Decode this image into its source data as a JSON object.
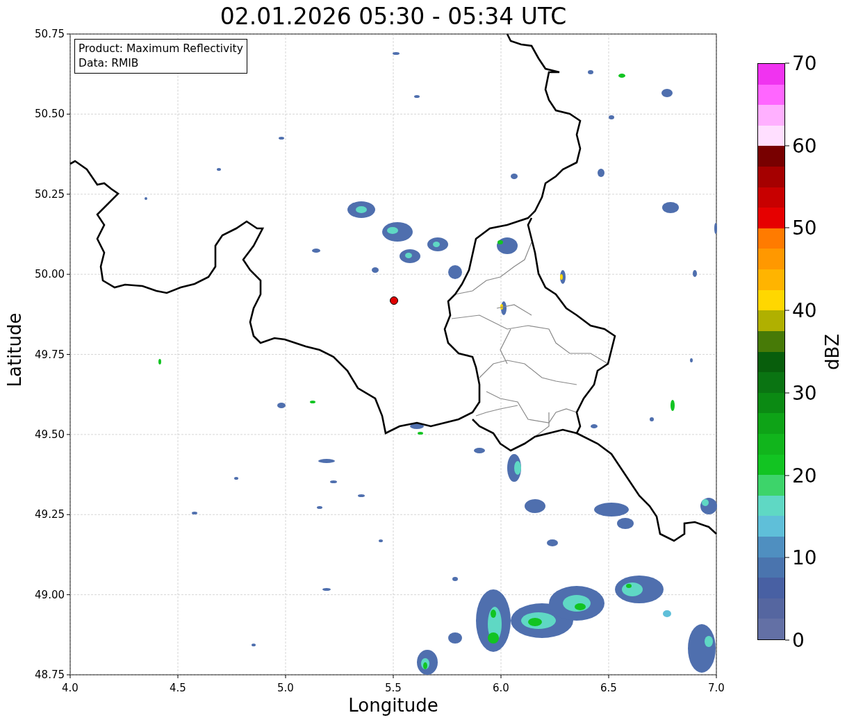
{
  "title": "02.01.2026 05:30 - 05:34 UTC",
  "info_box": [
    "Product: Maximum Reflectivity",
    "Data: RMIB"
  ],
  "x_axis": {
    "label": "Longitude",
    "ticks": [
      "4.0",
      "4.5",
      "5.0",
      "5.5",
      "6.0",
      "6.5",
      "7.0"
    ]
  },
  "y_axis": {
    "label": "Latitude",
    "ticks": [
      "50.75",
      "50.50",
      "50.25",
      "50.00",
      "49.75",
      "49.50",
      "49.25",
      "49.00",
      "48.75"
    ]
  },
  "colorbar": {
    "label": "dBZ",
    "ticks": [
      "70",
      "60",
      "50",
      "40",
      "30",
      "20",
      "10",
      "0"
    ],
    "segments": [
      {
        "color": "#f033f0"
      },
      {
        "color": "#ff66ff"
      },
      {
        "color": "#ffb0ff"
      },
      {
        "color": "#ffdfff"
      },
      {
        "color": "#780000"
      },
      {
        "color": "#a50000"
      },
      {
        "color": "#c80000"
      },
      {
        "color": "#e60000"
      },
      {
        "color": "#ff7b00"
      },
      {
        "color": "#ff9800"
      },
      {
        "color": "#ffb400"
      },
      {
        "color": "#ffd700"
      },
      {
        "color": "#b0b000"
      },
      {
        "color": "#477a07"
      },
      {
        "color": "#085e0c"
      },
      {
        "color": "#0a7412"
      },
      {
        "color": "#0b8a13"
      },
      {
        "color": "#0ea317"
      },
      {
        "color": "#11b51c"
      },
      {
        "color": "#12c422"
      },
      {
        "color": "#3dd46a"
      },
      {
        "color": "#5fd8c4"
      },
      {
        "color": "#5fbfd9"
      },
      {
        "color": "#4f8fc0"
      },
      {
        "color": "#4a74ae"
      },
      {
        "color": "#4860a3"
      },
      {
        "color": "#5566a0"
      },
      {
        "color": "#6370a5"
      }
    ]
  }
}
